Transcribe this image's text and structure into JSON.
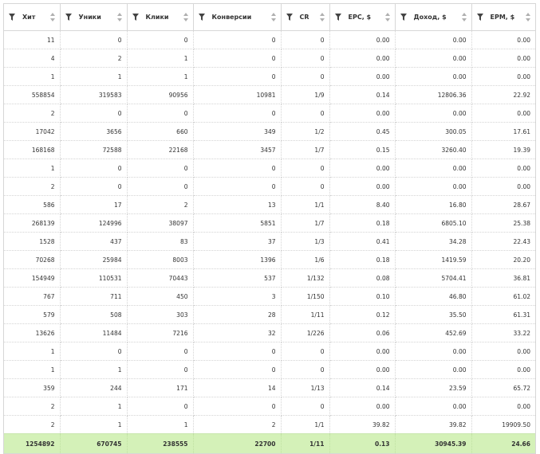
{
  "columns": [
    {
      "key": "hits",
      "label": "Хит"
    },
    {
      "key": "uniques",
      "label": "Уники"
    },
    {
      "key": "clicks",
      "label": "Клики"
    },
    {
      "key": "conversions",
      "label": "Конверсии"
    },
    {
      "key": "cr",
      "label": "CR"
    },
    {
      "key": "epc",
      "label": "EPC, $"
    },
    {
      "key": "income",
      "label": "Доход, $"
    },
    {
      "key": "epm",
      "label": "EPM, $"
    }
  ],
  "rows": [
    [
      "11",
      "0",
      "0",
      "0",
      "0",
      "0.00",
      "0.00",
      "0.00"
    ],
    [
      "4",
      "2",
      "1",
      "0",
      "0",
      "0.00",
      "0.00",
      "0.00"
    ],
    [
      "1",
      "1",
      "1",
      "0",
      "0",
      "0.00",
      "0.00",
      "0.00"
    ],
    [
      "558854",
      "319583",
      "90956",
      "10981",
      "1/9",
      "0.14",
      "12806.36",
      "22.92"
    ],
    [
      "2",
      "0",
      "0",
      "0",
      "0",
      "0.00",
      "0.00",
      "0.00"
    ],
    [
      "17042",
      "3656",
      "660",
      "349",
      "1/2",
      "0.45",
      "300.05",
      "17.61"
    ],
    [
      "168168",
      "72588",
      "22168",
      "3457",
      "1/7",
      "0.15",
      "3260.40",
      "19.39"
    ],
    [
      "1",
      "0",
      "0",
      "0",
      "0",
      "0.00",
      "0.00",
      "0.00"
    ],
    [
      "2",
      "0",
      "0",
      "0",
      "0",
      "0.00",
      "0.00",
      "0.00"
    ],
    [
      "586",
      "17",
      "2",
      "13",
      "1/1",
      "8.40",
      "16.80",
      "28.67"
    ],
    [
      "268139",
      "124996",
      "38097",
      "5851",
      "1/7",
      "0.18",
      "6805.10",
      "25.38"
    ],
    [
      "1528",
      "437",
      "83",
      "37",
      "1/3",
      "0.41",
      "34.28",
      "22.43"
    ],
    [
      "70268",
      "25984",
      "8003",
      "1396",
      "1/6",
      "0.18",
      "1419.59",
      "20.20"
    ],
    [
      "154949",
      "110531",
      "70443",
      "537",
      "1/132",
      "0.08",
      "5704.41",
      "36.81"
    ],
    [
      "767",
      "711",
      "450",
      "3",
      "1/150",
      "0.10",
      "46.80",
      "61.02"
    ],
    [
      "579",
      "508",
      "303",
      "28",
      "1/11",
      "0.12",
      "35.50",
      "61.31"
    ],
    [
      "13626",
      "11484",
      "7216",
      "32",
      "1/226",
      "0.06",
      "452.69",
      "33.22"
    ],
    [
      "1",
      "0",
      "0",
      "0",
      "0",
      "0.00",
      "0.00",
      "0.00"
    ],
    [
      "1",
      "1",
      "0",
      "0",
      "0",
      "0.00",
      "0.00",
      "0.00"
    ],
    [
      "359",
      "244",
      "171",
      "14",
      "1/13",
      "0.14",
      "23.59",
      "65.72"
    ],
    [
      "2",
      "1",
      "0",
      "0",
      "0",
      "0.00",
      "0.00",
      "0.00"
    ],
    [
      "2",
      "1",
      "1",
      "2",
      "1/1",
      "39.82",
      "39.82",
      "19909.50"
    ]
  ],
  "totals": [
    "1254892",
    "670745",
    "238555",
    "22700",
    "1/11",
    "0.13",
    "30945.39",
    "24.66"
  ],
  "icons": {
    "filter": "filter-icon",
    "sort": "sort-arrows-icon"
  },
  "colors": {
    "totals_bg": "#d4f1b8",
    "border": "#d7d7d7",
    "icon": "#444444",
    "sort": "#b0b0b0"
  }
}
